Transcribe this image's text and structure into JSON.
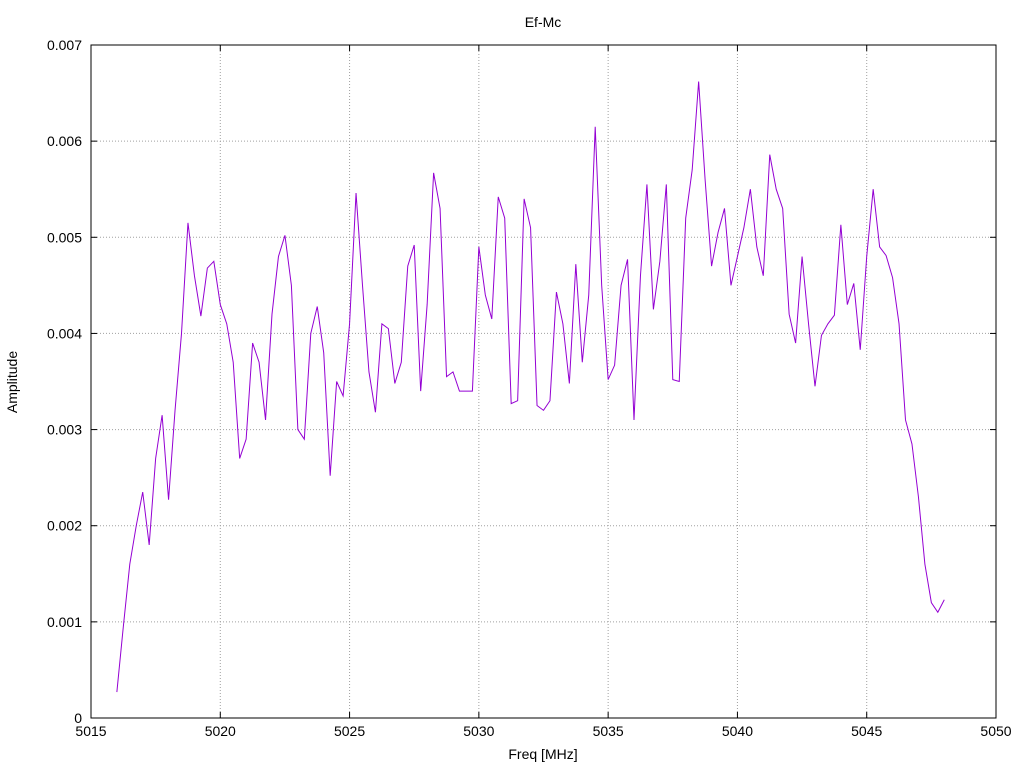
{
  "chart_data": {
    "type": "line",
    "title": "Ef-Mc",
    "xlabel": "Freq [MHz]",
    "ylabel": "Amplitude",
    "xlim": [
      5015,
      5050
    ],
    "ylim": [
      0,
      0.007
    ],
    "x_ticks": [
      "5015",
      "5020",
      "5025",
      "5030",
      "5035",
      "5040",
      "5045",
      "5050"
    ],
    "y_ticks": [
      "0",
      "0.001",
      "0.002",
      "0.003",
      "0.004",
      "0.005",
      "0.006",
      "0.007"
    ],
    "grid": true,
    "series_color": "#9400d3",
    "series": [
      {
        "x": [
          5016.0,
          5016.25,
          5016.5,
          5016.75,
          5017.0,
          5017.25,
          5017.5,
          5017.75,
          5018.0,
          5018.25,
          5018.5,
          5018.75,
          5019.0,
          5019.25,
          5019.5,
          5019.75,
          5020.0,
          5020.25,
          5020.5,
          5020.75,
          5021.0,
          5021.25,
          5021.5,
          5021.75,
          5022.0,
          5022.25,
          5022.5,
          5022.75,
          5023.0,
          5023.25,
          5023.5,
          5023.75,
          5024.0,
          5024.25,
          5024.5,
          5024.75,
          5025.0,
          5025.25,
          5025.5,
          5025.75,
          5026.0,
          5026.25,
          5026.5,
          5026.75,
          5027.0,
          5027.25,
          5027.5,
          5027.75,
          5028.0,
          5028.25,
          5028.5,
          5028.75,
          5029.0,
          5029.25,
          5029.5,
          5029.75,
          5030.0,
          5030.25,
          5030.5,
          5030.75,
          5031.0,
          5031.25,
          5031.5,
          5031.75,
          5032.0,
          5032.25,
          5032.5,
          5032.75,
          5033.0,
          5033.25,
          5033.5,
          5033.75,
          5034.0,
          5034.25,
          5034.5,
          5034.75,
          5035.0,
          5035.25,
          5035.5,
          5035.75,
          5036.0,
          5036.25,
          5036.5,
          5036.75,
          5037.0,
          5037.25,
          5037.5,
          5037.75,
          5038.0,
          5038.25,
          5038.5,
          5038.75,
          5039.0,
          5039.25,
          5039.5,
          5039.75,
          5040.0,
          5040.25,
          5040.5,
          5040.75,
          5041.0,
          5041.25,
          5041.5,
          5041.75,
          5042.0,
          5042.25,
          5042.5,
          5042.75,
          5043.0,
          5043.25,
          5043.5,
          5043.75,
          5044.0,
          5044.25,
          5044.5,
          5044.75,
          5045.0,
          5045.25,
          5045.5,
          5045.75,
          5046.0,
          5046.25,
          5046.5,
          5046.75,
          5047.0,
          5047.25,
          5047.5,
          5047.75,
          5048.0
        ],
        "values": [
          0.00027,
          0.00095,
          0.0016,
          0.002,
          0.00235,
          0.0018,
          0.0027,
          0.00315,
          0.00227,
          0.0032,
          0.004,
          0.00515,
          0.0046,
          0.00418,
          0.00468,
          0.00475,
          0.0043,
          0.0041,
          0.0037,
          0.0027,
          0.0029,
          0.0039,
          0.0037,
          0.0031,
          0.0042,
          0.0048,
          0.00502,
          0.0045,
          0.003,
          0.0029,
          0.004,
          0.00428,
          0.0038,
          0.00252,
          0.0035,
          0.00335,
          0.0041,
          0.00546,
          0.0045,
          0.0036,
          0.00318,
          0.0041,
          0.00405,
          0.00348,
          0.0037,
          0.0047,
          0.00492,
          0.0034,
          0.0043,
          0.00567,
          0.0053,
          0.00355,
          0.0036,
          0.0034,
          0.0034,
          0.0034,
          0.0049,
          0.0044,
          0.00415,
          0.00542,
          0.0052,
          0.00327,
          0.0033,
          0.0054,
          0.0051,
          0.00325,
          0.0032,
          0.0033,
          0.00443,
          0.0041,
          0.00348,
          0.00472,
          0.0037,
          0.0044,
          0.00615,
          0.0045,
          0.00352,
          0.00367,
          0.0045,
          0.00477,
          0.0031,
          0.0046,
          0.00555,
          0.00425,
          0.00475,
          0.00555,
          0.00352,
          0.0035,
          0.0052,
          0.0057,
          0.00662,
          0.0056,
          0.0047,
          0.00505,
          0.0053,
          0.0045,
          0.0048,
          0.0051,
          0.0055,
          0.0049,
          0.0046,
          0.00586,
          0.0055,
          0.0053,
          0.0042,
          0.0039,
          0.0048,
          0.0041,
          0.00345,
          0.00398,
          0.0041,
          0.00419,
          0.00513,
          0.0043,
          0.00452,
          0.00383,
          0.0048,
          0.0055,
          0.0049,
          0.00481,
          0.00458,
          0.0041,
          0.0031,
          0.00285,
          0.0023,
          0.0016,
          0.0012,
          0.0011,
          0.00123
        ]
      }
    ]
  }
}
